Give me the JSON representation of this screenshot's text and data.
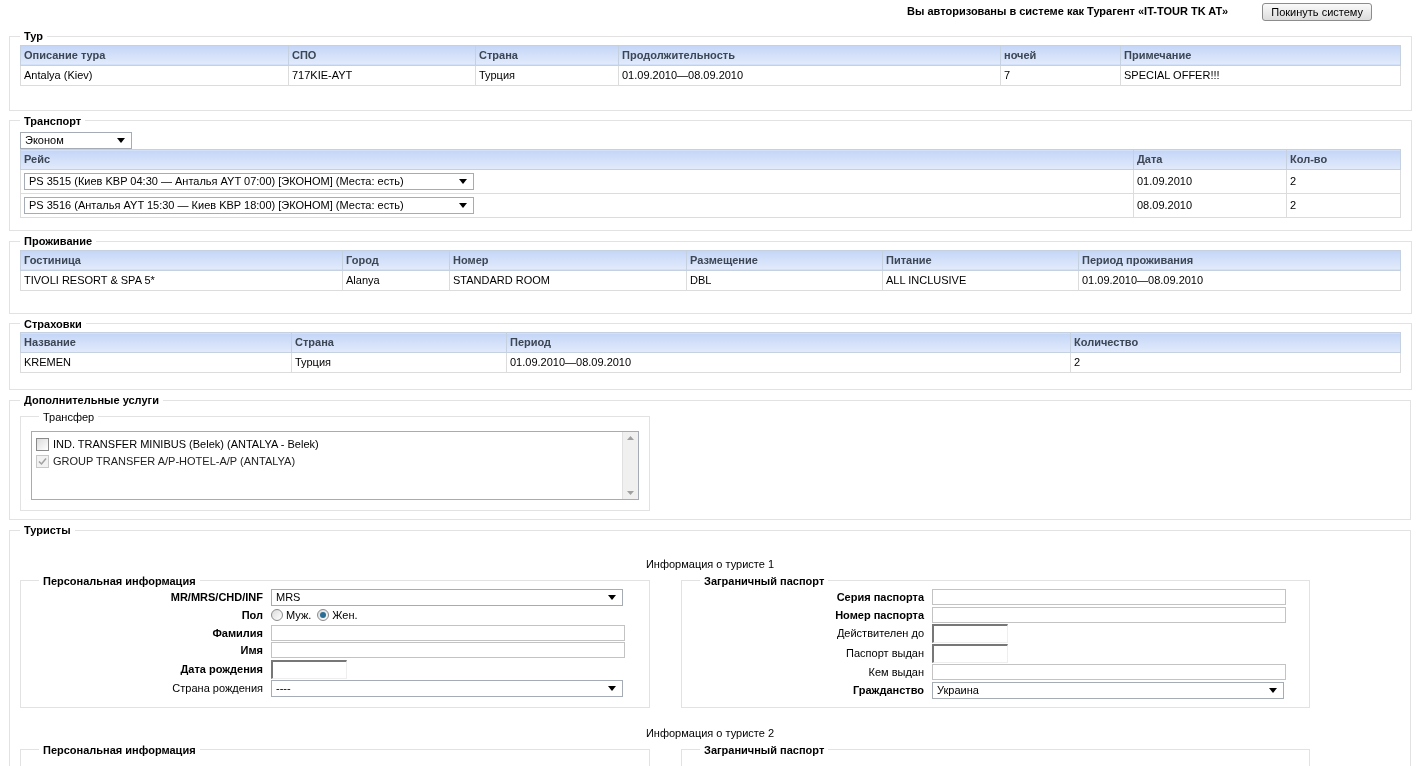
{
  "header": {
    "login_text": "Вы авторизованы в системе как Турагент «IT-TOUR TK AT»",
    "logout_button": "Покинуть систему"
  },
  "tour": {
    "title": "Тур",
    "columns": [
      "Описание тура",
      "СПО",
      "Страна",
      "Продолжительность",
      "ночей",
      "Примечание"
    ],
    "rows": [
      [
        "Antalya (Kiev)",
        "717KIE-AYT",
        "Турция",
        "01.09.2010—08.09.2010",
        "7",
        "SPECIAL OFFER!!!"
      ]
    ]
  },
  "transport": {
    "title": "Транспорт",
    "class_select": "Эконом",
    "columns": [
      "Рейс",
      "Дата",
      "Кол-во"
    ],
    "rows": [
      {
        "flight": "PS 3515 (Киев KBP 04:30 — Анталья AYT 07:00) [ЭКОНОМ] (Места: есть)",
        "date": "01.09.2010",
        "count": "2"
      },
      {
        "flight": "PS 3516 (Анталья AYT 15:30 — Киев KBP 18:00) [ЭКОНОМ] (Места: есть)",
        "date": "08.09.2010",
        "count": "2"
      }
    ]
  },
  "accommodation": {
    "title": "Проживание",
    "columns": [
      "Гостиница",
      "Город",
      "Номер",
      "Размещение",
      "Питание",
      "Период проживания"
    ],
    "rows": [
      [
        "TIVOLI RESORT & SPA 5*",
        "Alanya",
        "STANDARD ROOM",
        "DBL",
        "ALL INCLUSIVE",
        "01.09.2010—08.09.2010"
      ]
    ]
  },
  "insurance": {
    "title": "Страховки",
    "columns": [
      "Название",
      "Страна",
      "Период",
      "Количество"
    ],
    "rows": [
      [
        "KREMEN",
        "Турция",
        "01.09.2010—08.09.2010",
        "2"
      ]
    ]
  },
  "services": {
    "title": "Дополнительные услуги",
    "transfer": {
      "title": "Трансфер",
      "items": [
        {
          "label": "IND. TRANSFER MINIBUS (Belek) (ANTALYA - Belek)",
          "checked": false,
          "disabled": false
        },
        {
          "label": "GROUP TRANSFER A/P-HOTEL-A/P (ANTALYA)",
          "checked": true,
          "disabled": true
        }
      ]
    }
  },
  "tourists": {
    "title": "Туристы",
    "items": [
      {
        "heading": "Информация о туристе 1",
        "personal": {
          "title": "Персональная информация",
          "fields": [
            {
              "kind": "select",
              "label": "MR/MRS/CHD/INF",
              "required": true,
              "value": "MRS"
            },
            {
              "kind": "radio",
              "label": "Пол",
              "required": true,
              "options": [
                {
                  "label": "Муж.",
                  "selected": false
                },
                {
                  "label": "Жен.",
                  "selected": true
                }
              ]
            },
            {
              "kind": "text",
              "label": "Фамилия",
              "required": true
            },
            {
              "kind": "text",
              "label": "Имя",
              "required": true
            },
            {
              "kind": "date",
              "label": "Дата рождения",
              "required": true
            },
            {
              "kind": "select",
              "label": "Страна рождения",
              "required": false,
              "value": "----"
            }
          ]
        },
        "passport": {
          "title": "Заграничный паспорт",
          "fields": [
            {
              "kind": "text",
              "label": "Серия паспорта",
              "required": true
            },
            {
              "kind": "text",
              "label": "Номер паспорта",
              "required": true
            },
            {
              "kind": "date",
              "label": "Действителен до",
              "required": false
            },
            {
              "kind": "date",
              "label": "Паспорт выдан",
              "required": false
            },
            {
              "kind": "text",
              "label": "Кем выдан",
              "required": false
            },
            {
              "kind": "select",
              "label": "Гражданство",
              "required": true,
              "value": "Украина"
            }
          ]
        }
      },
      {
        "heading": "Информация о туристе 2",
        "personal": {
          "title": "Персональная информация"
        },
        "passport": {
          "title": "Заграничный паспорт"
        }
      }
    ]
  }
}
